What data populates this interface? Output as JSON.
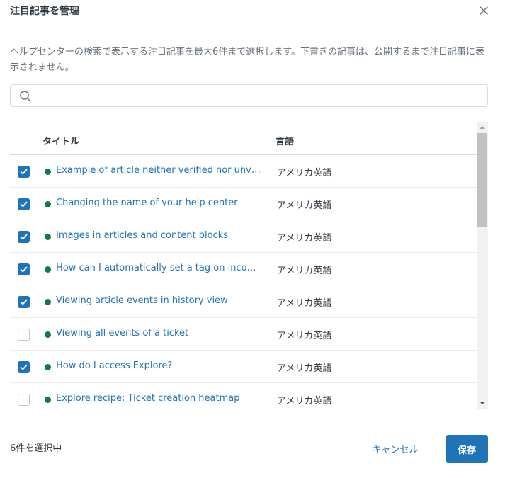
{
  "dialog": {
    "title": "注目記事を管理",
    "description": "ヘルプセンターの検索で表示する注目記事を最大6件まで選択します。下書きの記事は、公開するまで注目記事に表示されません。"
  },
  "search": {
    "value": "",
    "placeholder": ""
  },
  "table": {
    "headers": {
      "title": "タイトル",
      "language": "言語"
    },
    "rows": [
      {
        "checked": true,
        "title": "Example of article neither verified nor unverified",
        "language": "アメリカ英語"
      },
      {
        "checked": true,
        "title": "Changing the name of your help center",
        "language": "アメリカ英語"
      },
      {
        "checked": true,
        "title": "Images in articles and content blocks",
        "language": "アメリカ英語"
      },
      {
        "checked": true,
        "title": "How can I automatically set a tag on incoming tickets?",
        "language": "アメリカ英語"
      },
      {
        "checked": true,
        "title": "Viewing article events in history view",
        "language": "アメリカ英語"
      },
      {
        "checked": false,
        "title": "Viewing all events of a ticket",
        "language": "アメリカ英語"
      },
      {
        "checked": true,
        "title": "How do I access Explore?",
        "language": "アメリカ英語"
      },
      {
        "checked": false,
        "title": "Explore recipe: Ticket creation heatmap",
        "language": "アメリカ英語"
      }
    ]
  },
  "footer": {
    "selected_count": "6件を選択中",
    "cancel_label": "キャンセル",
    "save_label": "保存"
  },
  "colors": {
    "accent": "#1f73b7",
    "status_dot": "#117a4c"
  }
}
